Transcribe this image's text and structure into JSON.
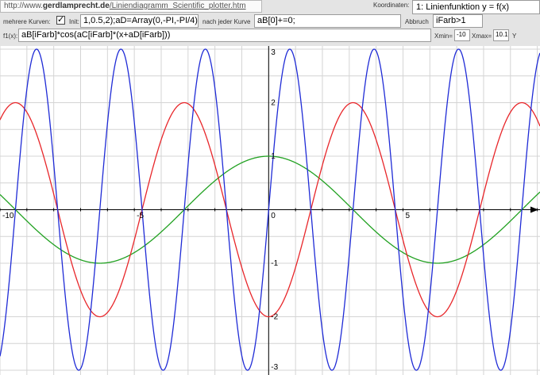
{
  "header": {
    "url_prefix": "http://www.",
    "url_domain": "gerdlamprecht.de",
    "url_path": "/Liniendiagramm_Scientific_plotter.htm",
    "coord_label": "Koordinaten:",
    "coord_value": "1: Linienfunktion y = f(x)"
  },
  "controls": {
    "multi_label": "mehrere Kurven:",
    "multi_checked": true,
    "init_label": "Init:",
    "init_value": "1,0.5,2);aD=Array(0,-PI,-PI/4)",
    "after_label": "nach jeder Kurve",
    "after_value": "aB[0]+=0;",
    "abort_label": "Abbruch",
    "abort_value": "iFarb>1",
    "f_label": "f1(x):",
    "f_value": "aB[iFarb]*cos(aC[iFarb]*(x+aD[iFarb]))",
    "xmin_label": "Xmin=",
    "xmin_value": "-10",
    "xmax_label": "Xmax=",
    "xmax_value": "10.1",
    "y_label": "Y"
  },
  "chart_data": {
    "type": "line",
    "function": "aB[iFarb]*cos(aC[iFarb]*(x+aD[iFarb]))",
    "xlim": [
      -10,
      10.1
    ],
    "ylim": [
      -3,
      3
    ],
    "x_ticks": [
      "-10",
      "-5",
      "0",
      "5"
    ],
    "y_ticks": [
      "3",
      "2",
      "1",
      "0",
      "-1",
      "-2",
      "-3"
    ],
    "grid": true,
    "series": [
      {
        "amplitude": 1,
        "frequency": 0.5,
        "phase": 0,
        "color": "#21a121"
      },
      {
        "amplitude": 2,
        "frequency": 1,
        "phase": -3.14159,
        "color": "#e8262a"
      },
      {
        "amplitude": 3,
        "frequency": 2,
        "phase": -0.7854,
        "color": "#1f2bd6"
      }
    ]
  }
}
